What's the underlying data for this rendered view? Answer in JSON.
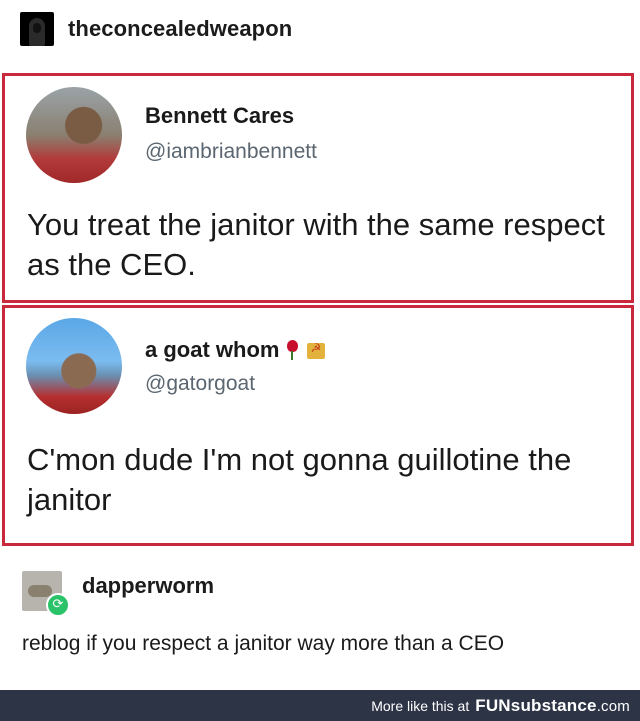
{
  "top_post": {
    "username": "theconcealedweapon"
  },
  "tweet1": {
    "name": "Bennett Cares",
    "handle": "@iambrianbennett",
    "text": "You treat the janitor with the same respect as the CEO."
  },
  "tweet2": {
    "name": "a goat whom",
    "handle": "@gatorgoat",
    "icons": [
      "rose-icon",
      "hammer-sickle-icon"
    ],
    "text": "C'mon dude I'm not gonna guillotine the janitor"
  },
  "reblog": {
    "username": "dapperworm",
    "text": "reblog if you respect a janitor way more than a CEO"
  },
  "footer": {
    "text": "More like this at",
    "brand_fun": "FUN",
    "brand_substance": "substance",
    "brand_tld": ".com"
  },
  "colors": {
    "border_red": "#c9283d",
    "footer_bg": "#2d3446",
    "reblog_green": "#2bc36a"
  }
}
